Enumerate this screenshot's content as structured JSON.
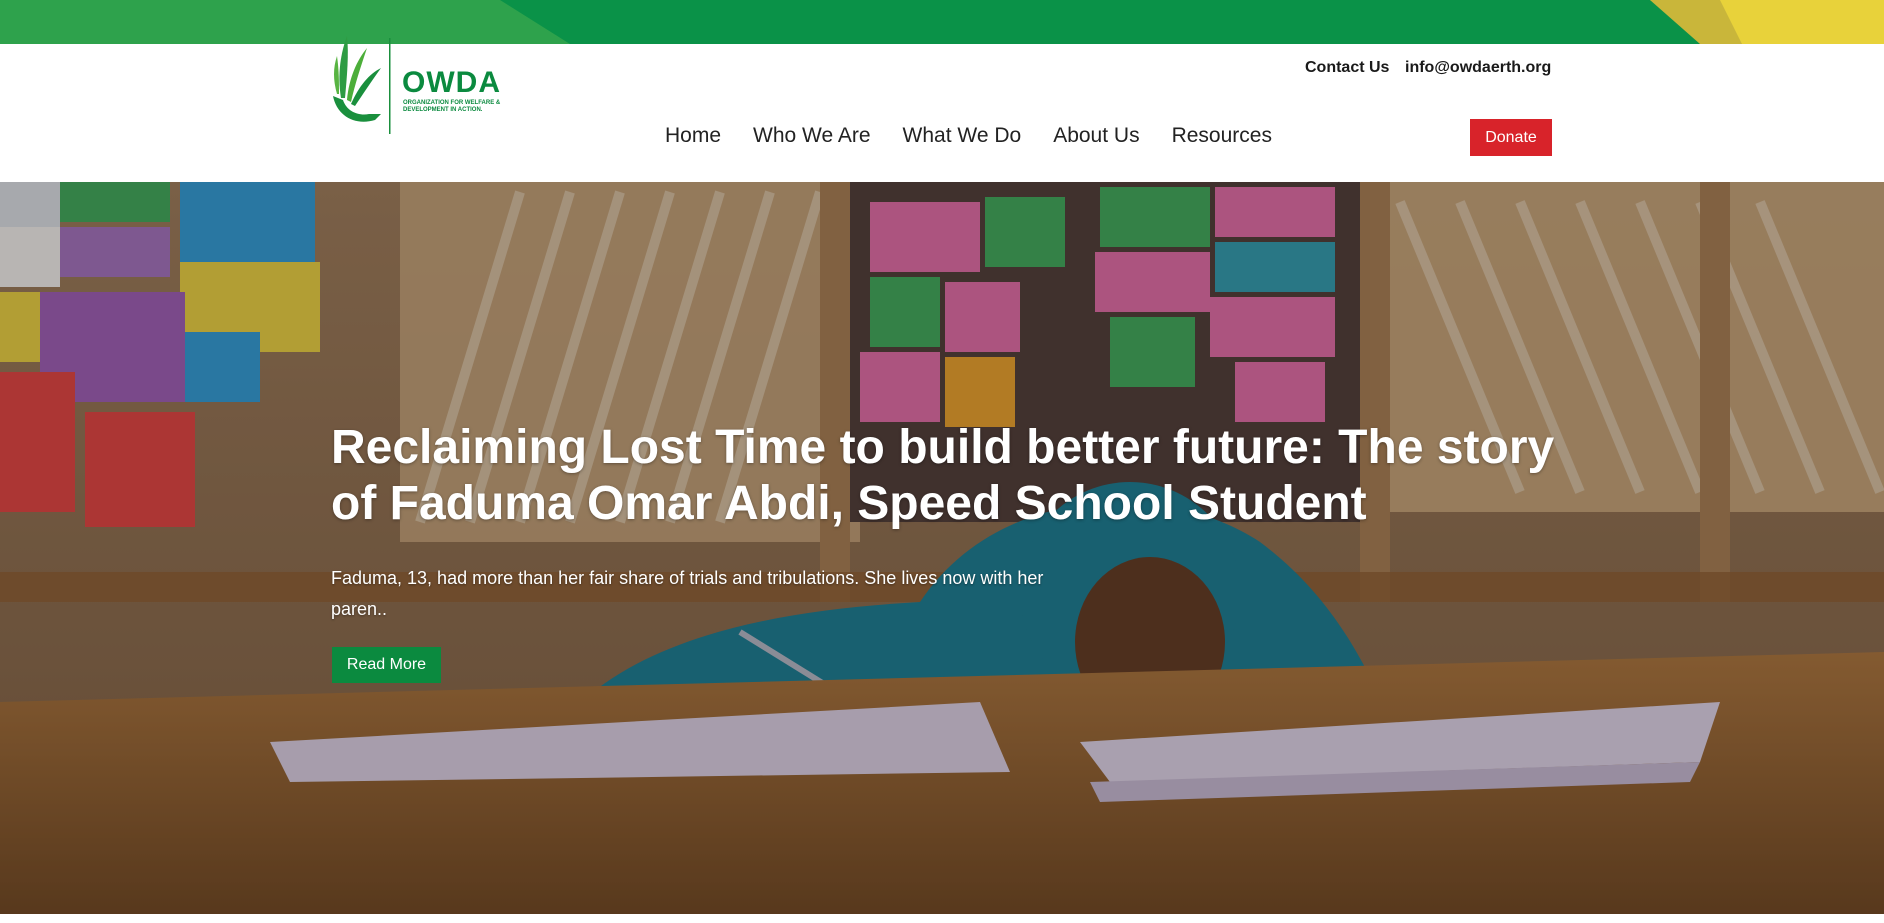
{
  "brand": {
    "name": "OWDA",
    "tagline": "ORGANIZATION FOR WELFARE & DEVELOPMENT IN ACTION."
  },
  "topbar": {
    "contact_label": "Contact Us",
    "email": "info@owdaerth.org"
  },
  "nav": {
    "items": [
      {
        "label": "Home"
      },
      {
        "label": "Who We Are"
      },
      {
        "label": "What We Do"
      },
      {
        "label": "About Us"
      },
      {
        "label": "Resources"
      }
    ]
  },
  "header": {
    "donate_label": "Donate"
  },
  "hero": {
    "title": "Reclaiming Lost Time to build better future: The story of Faduma Omar Abdi, Speed School Student",
    "excerpt": "Faduma, 13, had more than her fair share of trials and tribulations. She lives now with her paren..",
    "cta_label": "Read More"
  },
  "colors": {
    "brand_green": "#0b8a3f",
    "donate_red": "#d8232a",
    "stripe_yellow": "#e8d23a"
  }
}
